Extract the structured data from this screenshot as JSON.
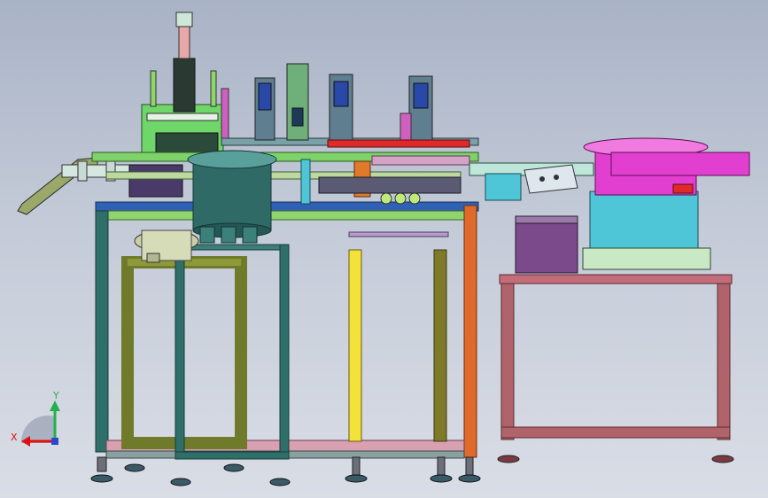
{
  "viewport": {
    "background_top": "#a9b3c6",
    "background_bottom": "#d9dde6"
  },
  "machine": {
    "main_frame_color": "#2e6f6a",
    "right_frame_color": "#b0636a",
    "feeder_bowl_color": "#e23fd0",
    "feeder_base_color": "#4fc6d8",
    "rotary_bowl_color": "#2f6a66",
    "rail_color": "#7fd16a",
    "column_yellow": "#f2e23a",
    "column_olive": "#7f7a2a"
  },
  "axis_triad": {
    "y_label": "Y",
    "x_label": "X",
    "y_color": "#22b14c",
    "x_color": "#e01010"
  }
}
